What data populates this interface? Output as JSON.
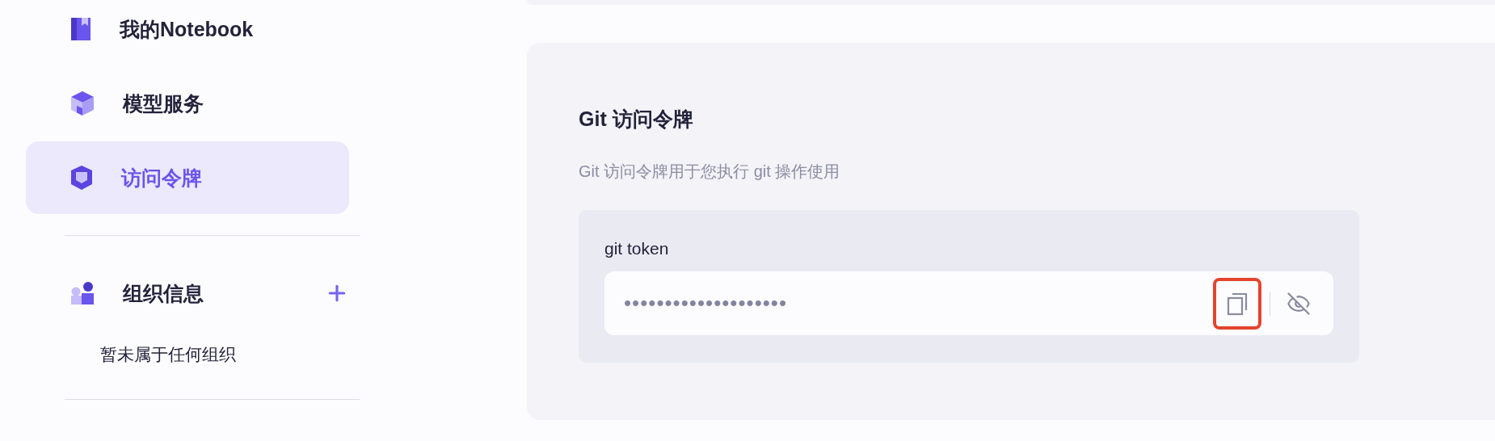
{
  "sidebar": {
    "items": [
      {
        "kind": "notebook",
        "label": "我的Notebook",
        "selected": false
      },
      {
        "kind": "model",
        "label": "模型服务",
        "selected": false
      },
      {
        "kind": "token",
        "label": "访问令牌",
        "selected": true
      }
    ]
  },
  "organization": {
    "title": "组织信息",
    "empty_text": "暂未属于任何组织"
  },
  "token_card": {
    "title": "Git 访问令牌",
    "description": "Git 访问令牌用于您执行 git 操作使用",
    "field_label": "git token",
    "value": "••••••••••••••••••••",
    "copy_highlighted": true
  }
}
